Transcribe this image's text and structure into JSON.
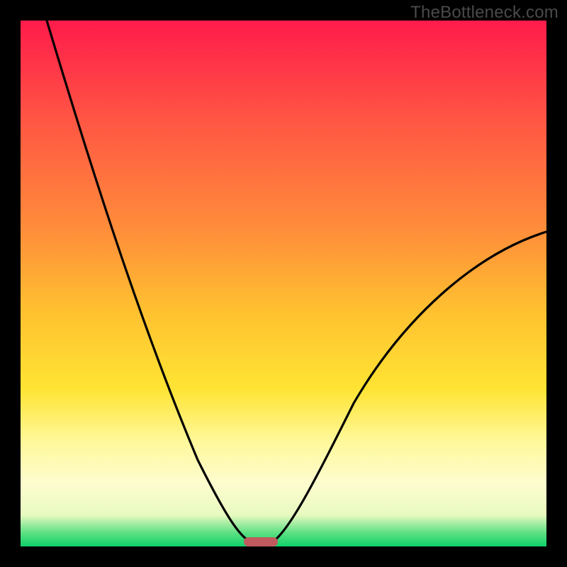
{
  "watermark": "TheBottleneck.com",
  "colors": {
    "frame": "#000000",
    "gradient_top": "#ff1b4b",
    "gradient_mid": "#ffe433",
    "gradient_low": "#fdfccf",
    "gradient_bottom": "#0fd169",
    "curve": "#000000",
    "marker": "#c05a5f"
  },
  "chart_data": {
    "type": "line",
    "title": "",
    "xlabel": "",
    "ylabel": "",
    "xlim": [
      0,
      100
    ],
    "ylim": [
      0,
      100
    ],
    "series": [
      {
        "name": "bottleneck-curve",
        "x": [
          5,
          10,
          15,
          20,
          25,
          30,
          35,
          40,
          44,
          46,
          48,
          50,
          55,
          60,
          65,
          70,
          75,
          80,
          85,
          90,
          95,
          100
        ],
        "y": [
          100,
          87,
          75,
          62,
          50,
          38,
          27,
          16,
          4,
          0,
          0,
          4,
          14,
          22,
          30,
          36,
          42,
          46,
          50,
          54,
          57,
          60
        ]
      }
    ],
    "annotations": [
      {
        "name": "optimal-marker",
        "shape": "pill",
        "x": 45,
        "y": 0,
        "width_pct": 6,
        "height_pct": 2
      }
    ],
    "notes": "x = relative hardware balance (arbitrary units). y = bottleneck severity percentage; 0 is optimal (green), 100 is worst (red). Minimum (flat segment) sits around x≈44–48. Values estimated from pixel positions; no axis ticks or labels are rendered in the source image."
  }
}
